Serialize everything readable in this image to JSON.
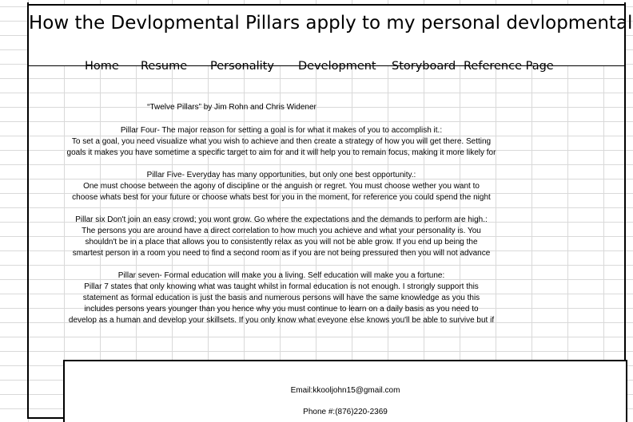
{
  "page": {
    "title": "How the Devlopmental Pillars apply to my personal devlopmental"
  },
  "nav": {
    "items": [
      {
        "label": "Home"
      },
      {
        "label": "Resume"
      },
      {
        "label": "Personality"
      },
      {
        "label": "Development"
      },
      {
        "label": "Storyboard"
      },
      {
        "label": "Reference Page"
      }
    ]
  },
  "content": {
    "source": "“Twelve Pillars” by Jim Rohn and Chris Widener",
    "pillar4": {
      "title": "Pillar Four- The major reason for setting a goal is for what it makes of you to accomplish it.:",
      "lines": [
        "To set a goal, you need visualize what you wish to achieve and then create a strategy of how you will get there. Setting",
        "goals it makes you have sometime a specific target to aim for and it will help you to remain focus, making it more likely for"
      ]
    },
    "pillar5": {
      "title": "Pillar Five- Everyday has many opportunities, but only one best opportunity.:",
      "lines": [
        "One must choose between the agony of discipline or the anguish or regret. You must choose wether you want to",
        "choose whats best for your future or choose whats best for you in the moment, for reference you could spend the night"
      ]
    },
    "pillar6": {
      "title": "Pillar six Don't join an easy crowd; you wont grow. Go where the expectations and the demands to perform are high.:",
      "lines": [
        "The persons you are around have a direct correlation to how much you achieve and what your personality is. You",
        "shouldn't be in a place that allows you to consistently relax as you will not be able grow. If you end up being the",
        "smartest person in a room you need to find a second room as if you are not being pressured then you will not advance"
      ]
    },
    "pillar7": {
      "title": "Pillar seven- Formal education will make you a living. Self education will make you a fortune:",
      "lines": [
        "Pillar 7 states that only knowing what was taught whilst in formal education is not enough. I strongly support this",
        "statement as formal education is just the basis and numerous persons will have the same knowledge as you this",
        "includes persons years younger than you hence why you must continue to learn on a daily basis as you need to",
        "develop as a human and develop your skillsets. If you only know what eveyone else knows you'll be able to survive but if"
      ]
    }
  },
  "footer": {
    "email": "Email:kkooljohn15@gmail.com",
    "phone": "Phone #:(876)220-2369"
  }
}
